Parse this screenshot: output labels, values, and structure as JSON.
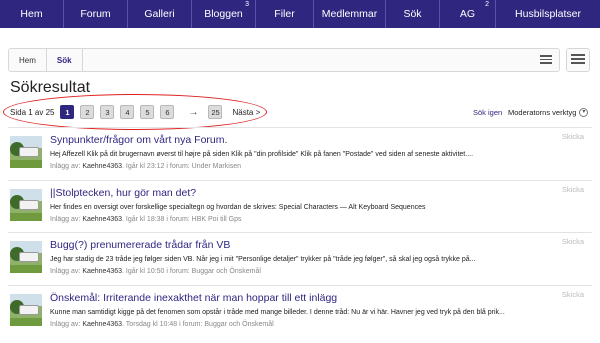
{
  "nav": {
    "items": [
      {
        "label": "Hem",
        "badge": ""
      },
      {
        "label": "Forum",
        "badge": ""
      },
      {
        "label": "Galleri",
        "badge": ""
      },
      {
        "label": "Bloggen",
        "badge": "3"
      },
      {
        "label": "Filer",
        "badge": ""
      },
      {
        "label": "Medlemmar",
        "badge": ""
      },
      {
        "label": "Sök",
        "badge": ""
      },
      {
        "label": "AG",
        "badge": "2"
      },
      {
        "label": "Husbilsplatser",
        "badge": ""
      }
    ]
  },
  "breadcrumb": {
    "home": "Hem",
    "current": "Sök"
  },
  "page_title": "Sökresultat",
  "pagination": {
    "status": "Sida 1 av 25",
    "current_page": 1,
    "pages": [
      "1",
      "2",
      "3",
      "4",
      "5",
      "6"
    ],
    "arrow": "→",
    "last": "25",
    "next": "Nästa >"
  },
  "actions": {
    "search_again": "Sök igen",
    "moderator_tools": "Moderatorns verktyg"
  },
  "results": [
    {
      "title": "Synpunkter/frågor om vårt nya Forum.",
      "snippet": "Hej Affezell Klik på dit brugernavn øverst til højre på siden Klik på \"din profilside\" Klik på fanen \"Postade\" ved siden af seneste aktivitet....",
      "meta_prefix": "Inlägg av:",
      "user": "Kaehne4363",
      "meta_suffix": ". Igår kl 23:12 i forum: Under Markisen",
      "share": "Skicka"
    },
    {
      "title": "||Stolptecken, hur gör man det?",
      "snippet": "Her findes en oversigt over forskellige specialtegn og hvordan de skrives: Special Characters — Alt Keyboard Sequences",
      "meta_prefix": "Inlägg av:",
      "user": "Kaehne4363",
      "meta_suffix": ". Igår kl 18:38 i forum: HBK Poi till Gps",
      "share": "Skicka"
    },
    {
      "title": "Bugg(?) prenumererade trådar från VB",
      "snippet": "Jeg har stadig de 23 tråde jeg følger siden VB. Når jeg i mit \"Personlige detaljer\" trykker på \"tråde jeg følger\", så skal jeg også trykke på...",
      "meta_prefix": "Inlägg av:",
      "user": "Kaehne4363",
      "meta_suffix": ". Igår kl 10:50 i forum: Buggar och Önskemål",
      "share": "Skicka"
    },
    {
      "title": "Önskemål: Irriterande inexakthet när man hoppar till ett inlägg",
      "snippet": "Kunne man samtidigt kigge på det fenomen som opstår i tråde med mange billeder. I denne tråd: Nu är vi här. Havner jeg ved tryk på den blå prik...",
      "meta_prefix": "Inlägg av:",
      "user": "Kaehne4363",
      "meta_suffix": ". Torsdag kl 10:48 i forum: Buggar och Önskemål",
      "share": "Skicka"
    }
  ],
  "colors": {
    "nav_bg": "#2f2680",
    "link": "#2f2680",
    "highlight_oval": "#e02020"
  }
}
